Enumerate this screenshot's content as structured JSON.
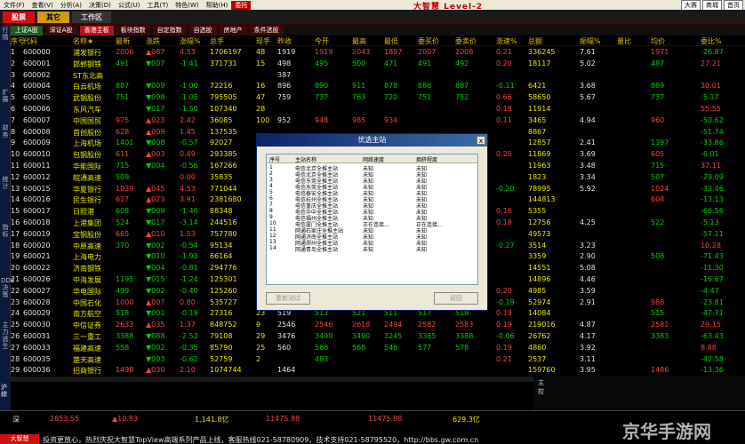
{
  "menu": {
    "items": [
      "文件(F)",
      "查看(V)",
      "分析(A)",
      "决策(D)",
      "公式(U)",
      "工具(T)",
      "特色(W)",
      "帮助(H)",
      "委托"
    ],
    "brand": "大智慧 Level-2",
    "right_buttons": [
      "大赛",
      "商城",
      "首页"
    ]
  },
  "toolbar": {
    "buttons": [
      "股票",
      "其它",
      "工作区"
    ]
  },
  "sectors": [
    "上证A股",
    "深证A股",
    "香港主板",
    "板块指数",
    "自定指数",
    "自选股",
    "房地产",
    "条件选股"
  ],
  "sidebar_tabs": [
    "行情",
    "扩展",
    "财务",
    "统计",
    "指标",
    "DDE决策",
    "主力逃生"
  ],
  "grid": {
    "columns": [
      "序号",
      "代码",
      "名称★",
      "最新",
      "涨跌",
      "涨幅%",
      "总手",
      "现手",
      "昨收",
      "今开",
      "最高",
      "最低",
      "委买价",
      "委卖价",
      "涨速%",
      "总额",
      "振幅%",
      "量比",
      "均价",
      "委比%"
    ],
    "rows": [
      {
        "n": "1",
        "code": "600000",
        "name": "浦发银行",
        "last": "2006",
        "chg": "▲087",
        "pct": "4.53",
        "vol": "1706197",
        "cur": "48",
        "prev": "1919",
        "open": "1919",
        "high": "2043",
        "low": "1897",
        "bid": "2007",
        "ask": "2008",
        "spd": "0.21",
        "amt": "336245",
        "amp": "7.61",
        "vr": "",
        "avg": "1971",
        "wr": "-26.87"
      },
      {
        "n": "2",
        "code": "600001",
        "name": "邯郸钢铁",
        "last": "491",
        "chg": "▼007",
        "pct": "-1.41",
        "vol": "371731",
        "cur": "15",
        "prev": "498",
        "open": "495",
        "high": "500",
        "low": "471",
        "bid": "491",
        "ask": "492",
        "spd": "0.20",
        "amt": "18117",
        "amp": "5.02",
        "vr": "",
        "avg": "487",
        "wr": "27.21"
      },
      {
        "n": "3",
        "code": "600002",
        "name": "ST东北高",
        "last": "",
        "chg": "",
        "pct": "",
        "vol": "",
        "cur": "",
        "prev": "387",
        "open": "",
        "high": "",
        "low": "",
        "bid": "",
        "ask": "",
        "spd": "",
        "amt": "",
        "amp": "",
        "vr": "",
        "avg": "",
        "wr": ""
      },
      {
        "n": "4",
        "code": "600004",
        "name": "白云机场",
        "last": "887",
        "chg": "▼009",
        "pct": "-1.00",
        "vol": "72216",
        "cur": "16",
        "prev": "896",
        "open": "890",
        "high": "911",
        "low": "878",
        "bid": "886",
        "ask": "887",
        "spd": "-0.11",
        "amt": "6421",
        "amp": "3.68",
        "vr": "",
        "avg": "889",
        "wr": "30.01"
      },
      {
        "n": "5",
        "code": "600005",
        "name": "武钢股份",
        "last": "751",
        "chg": "▼008",
        "pct": "-1.05",
        "vol": "795505",
        "cur": "47",
        "prev": "759",
        "open": "737",
        "high": "763",
        "low": "720",
        "bid": "751",
        "ask": "752",
        "spd": "0.66",
        "amt": "58650",
        "amp": "5.67",
        "vr": "",
        "avg": "737",
        "wr": "-5.17"
      },
      {
        "n": "6",
        "code": "600006",
        "name": "东风汽车",
        "last": "",
        "chg": "▼017",
        "pct": "-1.50",
        "vol": "107340",
        "cur": "28",
        "prev": "",
        "open": "",
        "high": "",
        "low": "",
        "bid": "",
        "ask": "",
        "spd": "0.18",
        "amt": "11914",
        "amp": "",
        "vr": "",
        "avg": "",
        "wr": "55.55"
      },
      {
        "n": "7",
        "code": "600007",
        "name": "中国国贸",
        "last": "975",
        "chg": "▲023",
        "pct": "2.42",
        "vol": "36085",
        "cur": "100",
        "prev": "952",
        "open": "948",
        "high": "985",
        "low": "934",
        "bid": "",
        "ask": "",
        "spd": "0.11",
        "amt": "3465",
        "amp": "4.94",
        "vr": "",
        "avg": "960",
        "wr": "-50.62"
      },
      {
        "n": "8",
        "code": "600008",
        "name": "首创股份",
        "last": "628",
        "chg": "▲009",
        "pct": "1.45",
        "vol": "137535",
        "cur": "",
        "prev": "",
        "open": "",
        "high": "",
        "low": "",
        "bid": "",
        "ask": "",
        "spd": "",
        "amt": "8867",
        "amp": "",
        "vr": "",
        "avg": "",
        "wr": "-51.74"
      },
      {
        "n": "9",
        "code": "600009",
        "name": "上海机场",
        "last": "1401",
        "chg": "▼008",
        "pct": "-0.57",
        "vol": "92027",
        "cur": "",
        "prev": "",
        "open": "",
        "high": "",
        "low": "",
        "bid": "",
        "ask": "",
        "spd": "",
        "amt": "12857",
        "amp": "2.41",
        "vr": "",
        "avg": "1397",
        "wr": "-33.86"
      },
      {
        "n": "10",
        "code": "600010",
        "name": "包钢股份",
        "last": "611",
        "chg": "▲003",
        "pct": "0.49",
        "vol": "293385",
        "cur": "",
        "prev": "",
        "open": "",
        "high": "",
        "low": "",
        "bid": "",
        "ask": "",
        "spd": "0.25",
        "amt": "11869",
        "amp": "3.69",
        "vr": "",
        "avg": "605",
        "wr": "-6.01"
      },
      {
        "n": "11",
        "code": "600011",
        "name": "华能国际",
        "last": "715",
        "chg": "▼004",
        "pct": "-0.56",
        "vol": "167266",
        "cur": "",
        "prev": "",
        "open": "",
        "high": "",
        "low": "",
        "bid": "",
        "ask": "",
        "spd": "",
        "amt": "11963",
        "amp": "3.48",
        "vr": "",
        "avg": "715",
        "wr": "37.11"
      },
      {
        "n": "12",
        "code": "600012",
        "name": "皖通高速",
        "last": "509",
        "chg": "",
        "pct": "0.00",
        "vol": "35835",
        "cur": "",
        "prev": "",
        "open": "",
        "high": "",
        "low": "",
        "bid": "",
        "ask": "",
        "spd": "",
        "amt": "1823",
        "amp": "3.34",
        "vr": "",
        "avg": "507",
        "wr": "-29.09"
      },
      {
        "n": "13",
        "code": "600015",
        "name": "华夏银行",
        "last": "1039",
        "chg": "▲045",
        "pct": "4.53",
        "vol": "771044",
        "cur": "",
        "prev": "",
        "open": "",
        "high": "",
        "low": "",
        "bid": "",
        "ask": "",
        "spd": "-0.20",
        "amt": "78995",
        "amp": "5.92",
        "vr": "",
        "avg": "1024",
        "wr": "-33.46"
      },
      {
        "n": "14",
        "code": "600016",
        "name": "民生银行",
        "last": "617",
        "chg": "▲023",
        "pct": "3.91",
        "vol": "2381680",
        "cur": "",
        "prev": "",
        "open": "",
        "high": "",
        "low": "",
        "bid": "",
        "ask": "",
        "spd": "",
        "amt": "144813",
        "amp": "",
        "vr": "",
        "avg": "608",
        "wr": "-13.13"
      },
      {
        "n": "15",
        "code": "600017",
        "name": "日照港",
        "last": "608",
        "chg": "▼009",
        "pct": "-1.46",
        "vol": "88348",
        "cur": "",
        "prev": "",
        "open": "",
        "high": "",
        "low": "",
        "bid": "",
        "ask": "",
        "spd": "0.16",
        "amt": "5355",
        "amp": "",
        "vr": "",
        "avg": "",
        "wr": "-66.56"
      },
      {
        "n": "16",
        "code": "600018",
        "name": "上港集团",
        "last": "524",
        "chg": "▼017",
        "pct": "-3.14",
        "vol": "244516",
        "cur": "",
        "prev": "",
        "open": "",
        "high": "",
        "low": "",
        "bid": "",
        "ask": "",
        "spd": "0.18",
        "amt": "12756",
        "amp": "4.25",
        "vr": "",
        "avg": "522",
        "wr": "-5.13"
      },
      {
        "n": "17",
        "code": "600019",
        "name": "宝钢股份",
        "last": "665",
        "chg": "▲010",
        "pct": "1.53",
        "vol": "757780",
        "cur": "",
        "prev": "",
        "open": "",
        "high": "",
        "low": "",
        "bid": "",
        "ask": "",
        "spd": "",
        "amt": "49573",
        "amp": "",
        "vr": "",
        "avg": "",
        "wr": "-57.11"
      },
      {
        "n": "18",
        "code": "600020",
        "name": "中原高速",
        "last": "370",
        "chg": "▼002",
        "pct": "-0.54",
        "vol": "95134",
        "cur": "",
        "prev": "",
        "open": "",
        "high": "",
        "low": "",
        "bid": "",
        "ask": "",
        "spd": "-0.27",
        "amt": "3514",
        "amp": "3.23",
        "vr": "",
        "avg": "",
        "wr": "10.28"
      },
      {
        "n": "19",
        "code": "600021",
        "name": "上海电力",
        "last": "",
        "chg": "▼010",
        "pct": "-1.93",
        "vol": "66164",
        "cur": "",
        "prev": "",
        "open": "",
        "high": "",
        "low": "",
        "bid": "",
        "ask": "",
        "spd": "",
        "amt": "3359",
        "amp": "2.90",
        "vr": "",
        "avg": "508",
        "wr": "-71.43"
      },
      {
        "n": "20",
        "code": "600022",
        "name": "济南钢铁",
        "last": "",
        "chg": "▼004",
        "pct": "-0.81",
        "vol": "294776",
        "cur": "",
        "prev": "",
        "open": "",
        "high": "",
        "low": "",
        "bid": "",
        "ask": "",
        "spd": "",
        "amt": "14551",
        "amp": "5.08",
        "vr": "",
        "avg": "",
        "wr": "-11.30"
      },
      {
        "n": "21",
        "code": "600026",
        "name": "中海发展",
        "last": "1195",
        "chg": "▼015",
        "pct": "-1.24",
        "vol": "125301",
        "cur": "",
        "prev": "",
        "open": "",
        "high": "",
        "low": "",
        "bid": "",
        "ask": "",
        "spd": "",
        "amt": "14896",
        "amp": "4.46",
        "vr": "",
        "avg": "",
        "wr": "-16.67"
      },
      {
        "n": "22",
        "code": "600027",
        "name": "华电国际",
        "last": "499",
        "chg": "▼002",
        "pct": "-0.40",
        "vol": "125260",
        "cur": "",
        "prev": "",
        "open": "",
        "high": "",
        "low": "",
        "bid": "",
        "ask": "",
        "spd": "0.20",
        "amt": "4985",
        "amp": "3.59",
        "vr": "",
        "avg": "",
        "wr": "-4.47"
      },
      {
        "n": "23",
        "code": "600028",
        "name": "中国石化",
        "last": "1000",
        "chg": "▲007",
        "pct": "0.80",
        "vol": "535727",
        "cur": "",
        "prev": "",
        "open": "",
        "high": "",
        "low": "",
        "bid": "",
        "ask": "",
        "spd": "-0.19",
        "amt": "52974",
        "amp": "2.91",
        "vr": "",
        "avg": "988",
        "wr": "-23.81"
      },
      {
        "n": "24",
        "code": "600029",
        "name": "南方航空",
        "last": "518",
        "chg": "▼001",
        "pct": "-0.19",
        "vol": "27316",
        "cur": "23",
        "prev": "519",
        "open": "513",
        "high": "521",
        "low": "511",
        "bid": "517",
        "ask": "518",
        "spd": "0.19",
        "amt": "14084",
        "amp": "",
        "vr": "",
        "avg": "515",
        "wr": "-47.71"
      },
      {
        "n": "25",
        "code": "600030",
        "name": "中信证券",
        "last": "2633",
        "chg": "▲035",
        "pct": "1.37",
        "vol": "848752",
        "cur": "9",
        "prev": "2546",
        "open": "2546",
        "high": "2618",
        "low": "2494",
        "bid": "2582",
        "ask": "2583",
        "spd": "0.19",
        "amt": "219016",
        "amp": "4.87",
        "vr": "",
        "avg": "2581",
        "wr": "29.15"
      },
      {
        "n": "26",
        "code": "600031",
        "name": "三一重工",
        "last": "3388",
        "chg": "▼088",
        "pct": "-2.53",
        "vol": "79108",
        "cur": "29",
        "prev": "3476",
        "open": "3490",
        "high": "3490",
        "low": "3245",
        "bid": "3385",
        "ask": "3388",
        "spd": "-0.06",
        "amt": "26762",
        "amp": "4.17",
        "vr": "",
        "avg": "3383",
        "wr": "-63.43"
      },
      {
        "n": "27",
        "code": "600033",
        "name": "福建高速",
        "last": "558",
        "chg": "▼002",
        "pct": "-0.35",
        "vol": "85790",
        "cur": "25",
        "prev": "560",
        "open": "568",
        "high": "568",
        "low": "546",
        "bid": "577",
        "ask": "578",
        "spd": "0.19",
        "amt": "4860",
        "amp": "3.92",
        "vr": "",
        "avg": "",
        "wr": "8.88"
      },
      {
        "n": "28",
        "code": "600035",
        "name": "楚天高速",
        "last": "",
        "chg": "▼003",
        "pct": "-0.62",
        "vol": "52759",
        "cur": "2",
        "prev": "",
        "open": "483",
        "high": "",
        "low": "",
        "bid": "",
        "ask": "",
        "spd": "0.21",
        "amt": "2537",
        "amp": "3.11",
        "vr": "",
        "avg": "",
        "wr": "-42.58"
      },
      {
        "n": "29",
        "code": "600036",
        "name": "招商银行",
        "last": "1498",
        "chg": "▲030",
        "pct": "2.10",
        "vol": "1074744",
        "cur": "",
        "prev": "1464",
        "open": "",
        "high": "",
        "low": "",
        "bid": "",
        "ask": "",
        "spd": "",
        "amt": "159760",
        "amp": "3.95",
        "vr": "",
        "avg": "1486",
        "wr": "-13.36"
      }
    ]
  },
  "dialog": {
    "title": "优选主站",
    "close_label": "x",
    "columns": [
      "序号",
      "主站名称",
      "网络速度",
      "拥挤程度"
    ],
    "rows": [
      {
        "n": "1",
        "name": "电信北京全推主站",
        "speed": "未知",
        "load": "未知"
      },
      {
        "n": "2",
        "name": "电信北京全推主站",
        "speed": "未知",
        "load": "未知"
      },
      {
        "n": "3",
        "name": "电信东莞全推主站",
        "speed": "未知",
        "load": "未知"
      },
      {
        "n": "4",
        "name": "电信东莞全推主站",
        "speed": "未知",
        "load": "未知"
      },
      {
        "n": "5",
        "name": "电信泰安全推主站",
        "speed": "未知",
        "load": "未知"
      },
      {
        "n": "6",
        "name": "电信杭州全推主站",
        "speed": "未知",
        "load": "未知"
      },
      {
        "n": "7",
        "name": "电信重庆全推主站",
        "speed": "未知",
        "load": "未知"
      },
      {
        "n": "8",
        "name": "电信华中全推主站",
        "speed": "未知",
        "load": "未知"
      },
      {
        "n": "9",
        "name": "电信福州全推主站",
        "speed": "未知",
        "load": "未知"
      },
      {
        "n": "10",
        "name": "电信厦门全推主站",
        "speed": "正在连接...",
        "load": "正在连接..."
      },
      {
        "n": "11",
        "name": "网通石家庄全推主站",
        "speed": "未知",
        "load": "未知"
      },
      {
        "n": "12",
        "name": "网通济南全推主站",
        "speed": "未知",
        "load": "未知"
      },
      {
        "n": "13",
        "name": "网通郑州全推主站",
        "speed": "未知",
        "load": "未知"
      },
      {
        "n": "14",
        "name": "网通青岛全推主站",
        "speed": "未知",
        "load": "未知"
      }
    ],
    "retest_label": "重新测试",
    "back_label": "返回"
  },
  "status": {
    "sh_index": "2853.55",
    "sh_chg": "▲10.83",
    "sh_amt": "1,141.8亿",
    "sz_index": "11475.88",
    "sz_chg": "11475.88",
    "sz_amt": "629.3亿",
    "label": "深"
  },
  "ticker": {
    "badge": "大智慧",
    "text": "投资更放心，热烈庆祝大智慧TopView高端系列产品上线，客服热线021-58780909，技术支持021-58795520，http://bbs.gw.com.cn"
  },
  "rightpanel": {
    "label": "主控"
  },
  "leftstrip": {
    "label": "沪综"
  },
  "watermark": "京华手游网"
}
